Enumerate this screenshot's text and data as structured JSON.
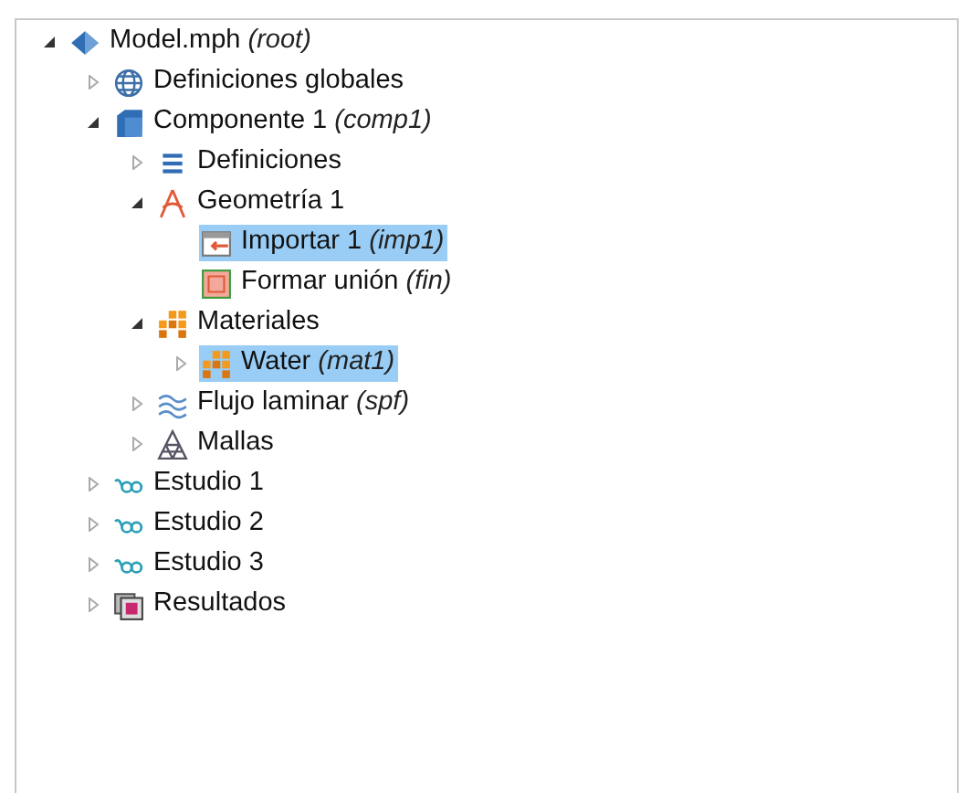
{
  "tree": [
    {
      "label": "Model.mph",
      "tag": "(root)",
      "kind": "model",
      "expanded": true,
      "selected": false,
      "children": [
        {
          "label": "Definiciones globales",
          "kind": "globe",
          "expanded": false,
          "selected": false
        },
        {
          "label": "Componente 1",
          "tag": "(comp1)",
          "kind": "component",
          "expanded": true,
          "selected": false,
          "children": [
            {
              "label": "Definiciones",
              "kind": "list",
              "expanded": false,
              "selected": false
            },
            {
              "label": "Geometría 1",
              "kind": "geometry",
              "expanded": true,
              "selected": false,
              "children": [
                {
                  "label": "Importar 1",
                  "tag": "(imp1)",
                  "kind": "import",
                  "selected": true
                },
                {
                  "label": "Formar unión",
                  "tag": "(fin)",
                  "kind": "union",
                  "selected": false
                }
              ]
            },
            {
              "label": "Materiales",
              "kind": "materials",
              "expanded": true,
              "selected": false,
              "children": [
                {
                  "label": "Water",
                  "tag": "(mat1)",
                  "kind": "materials",
                  "expanded": false,
                  "selected": true
                }
              ]
            },
            {
              "label": "Flujo laminar",
              "tag": "(spf)",
              "kind": "flow",
              "expanded": false,
              "selected": false
            },
            {
              "label": "Mallas",
              "kind": "mesh",
              "expanded": false,
              "selected": false
            }
          ]
        },
        {
          "label": "Estudio 1",
          "kind": "study",
          "expanded": false,
          "selected": false
        },
        {
          "label": "Estudio 2",
          "kind": "study",
          "expanded": false,
          "selected": false
        },
        {
          "label": "Estudio 3",
          "kind": "study",
          "expanded": false,
          "selected": false
        },
        {
          "label": "Resultados",
          "kind": "results",
          "expanded": false,
          "selected": false
        }
      ]
    }
  ]
}
